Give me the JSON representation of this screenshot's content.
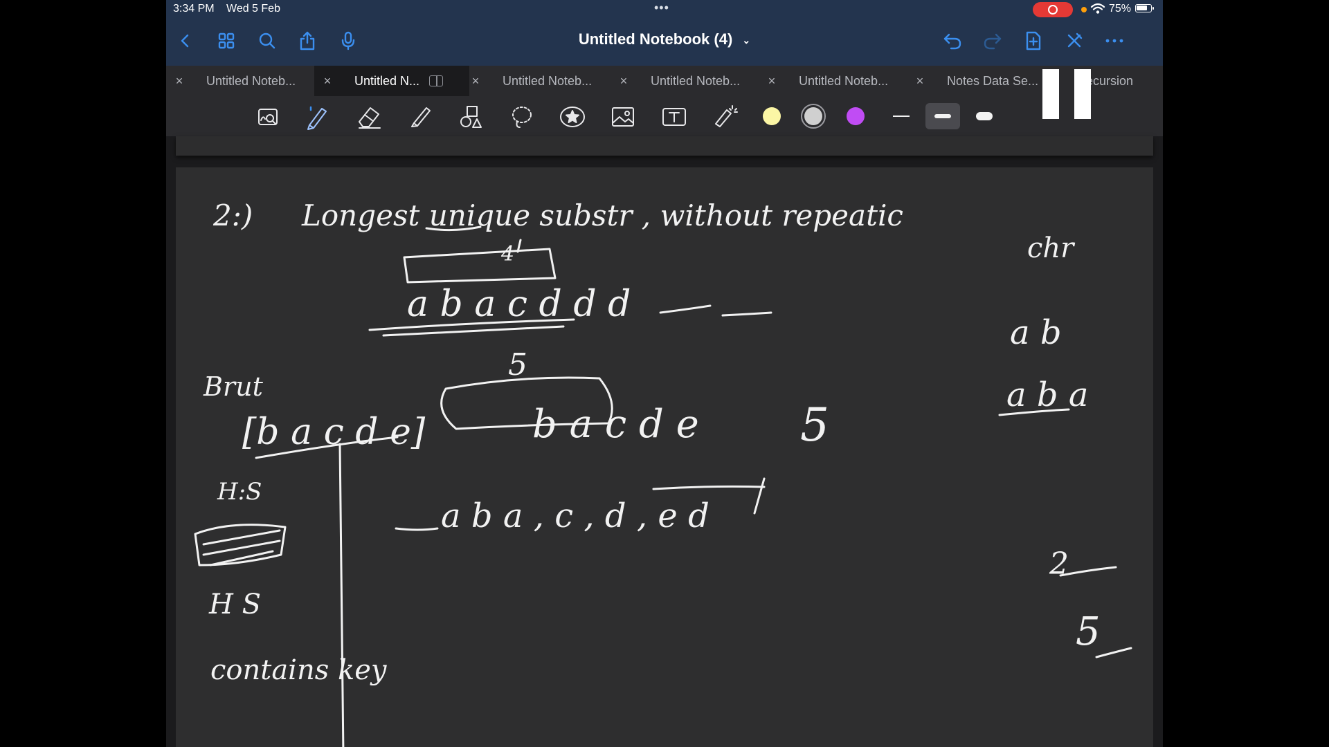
{
  "status_bar": {
    "time": "3:34 PM",
    "date": "Wed 5 Feb",
    "battery": "75%"
  },
  "nav": {
    "title": "Untitled Notebook (4)",
    "icons": {
      "back": "chevron-left-icon",
      "grid": "grid-icon",
      "search": "search-icon",
      "share": "share-icon",
      "mic": "microphone-icon",
      "undo": "undo-icon",
      "redo": "redo-icon",
      "add_page": "add-page-icon",
      "close_pen": "pen-off-icon",
      "more": "more-icon"
    }
  },
  "tabs": [
    {
      "label": "Untitled Noteb...",
      "active": false
    },
    {
      "label": "Untitled N...",
      "active": true
    },
    {
      "label": "Untitled Noteb...",
      "active": false
    },
    {
      "label": "Untitled Noteb...",
      "active": false
    },
    {
      "label": "Untitled Noteb...",
      "active": false
    },
    {
      "label": "Notes Data Se...",
      "active": false
    },
    {
      "label": "Recursion",
      "active": false
    }
  ],
  "toolbar": {
    "tools": [
      "zoom-window-icon",
      "pen-icon",
      "eraser-icon",
      "highlighter-icon",
      "shapes-icon",
      "lasso-icon",
      "sticker-icon",
      "image-icon",
      "text-box-icon",
      "laser-pointer-icon"
    ],
    "selected_tool": "pen-icon",
    "colors": [
      "#fbf6a5",
      "#d0d0d0",
      "#c04cf4"
    ],
    "selected_color": "#d0d0d0",
    "stroke_widths": [
      "thin",
      "medium",
      "thick"
    ],
    "selected_stroke": "medium"
  },
  "notes": {
    "question": "2:)",
    "heading": "Longest unique substr , without repeatic",
    "heading_cont": "chr",
    "example_string": "a b a c d d d",
    "top_count": "4",
    "window_length": "5",
    "brute_label": "Brut",
    "brute_set": "[b a c d e]",
    "boxed_string": "b a c d e",
    "boxed_count": "5",
    "answer_ab": "a b",
    "answer_aba": "a b a",
    "char_list": "a b a , c , d , e d",
    "his_label": "H:S",
    "his_label2": "H S",
    "contains_label": "contains key",
    "right_two": "2",
    "right_five": "5"
  }
}
